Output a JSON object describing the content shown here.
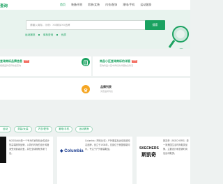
{
  "header": {
    "brand": "查询",
    "nav": [
      "首页",
      "装备评测",
      "男装/女装",
      "内衣/配饰",
      "潮电/手机",
      "运动健身"
    ]
  },
  "hero": {
    "search_placeholder": "请输入商标，示例：XX商标/XX品牌",
    "search_button": "搜索",
    "tags": [
      "运动潮流",
      "商标查询",
      "优质"
    ]
  },
  "features": [
    {
      "title": "查询商标品牌信息",
      "badge": "NEW",
      "subtitle": "根据品牌名称快速查询"
    },
    {
      "title": "商品小区查询商标的详细",
      "badge": "NEW",
      "subtitle": "查询商品小区中商标的详细信息情况"
    },
    {
      "title": "品牌列表",
      "subtitle": "浏览品牌列表"
    }
  ],
  "category_tabs": [
    "运动",
    "男装/女装",
    "内衣/配饰",
    "潮电/手机",
    "运动健身"
  ],
  "brands": [
    {
      "text": "MOSSMAN是一个专为时尚年轻女性设计的高端服饰品牌，以简约时尚的设计风格深受消费者喜爱，并在全球拥有多家门店。"
    },
    {
      "logo": "Columbia",
      "text": "Columbia（哥伦比亚）户外服装及运动用品知名品牌，创立于1938年，总部位于美国俄勒冈州，专注于户外服装鞋品。"
    },
    {
      "logo": "SKECHERS",
      "logo_sub": "斯凯奇",
      "text": "斯凯奇（SKECHERS）是一家美国生活时尚鞋类品牌，主要设计和营销时尚及运动鞋类。"
    }
  ],
  "colors": {
    "accent": "#1aa260",
    "badge": "#f25c4e"
  }
}
